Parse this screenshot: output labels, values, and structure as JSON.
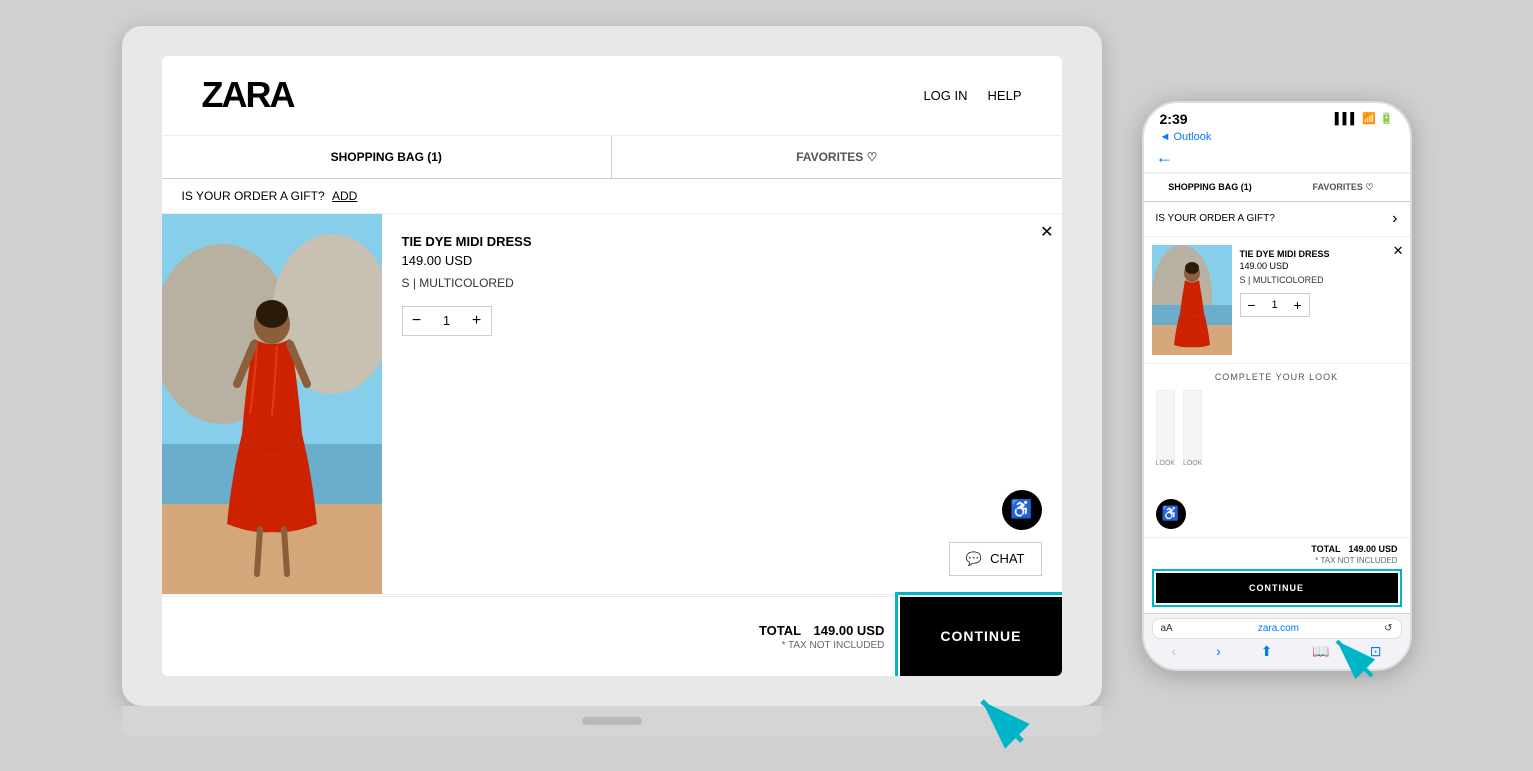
{
  "laptop": {
    "header": {
      "logo": "ZARA",
      "nav": [
        {
          "label": "LOG IN"
        },
        {
          "label": "HELP"
        }
      ]
    },
    "tabs": [
      {
        "label": "SHOPPING BAG (1)",
        "active": true
      },
      {
        "label": "FAVORITES ♡",
        "active": false
      }
    ],
    "gift_bar": {
      "text": "IS YOUR ORDER A GIFT?",
      "link": "ADD"
    },
    "product": {
      "name": "TIE DYE MIDI DRESS",
      "price": "149.00 USD",
      "variant": "S | MULTICOLORED",
      "quantity": 1
    },
    "accessibility_icon": "♿",
    "chat_label": "CHAT",
    "checkout": {
      "total_label": "TOTAL",
      "total_amount": "149.00 USD",
      "tax_note": "* TAX NOT INCLUDED",
      "continue_label": "CONTINUE"
    }
  },
  "mobile": {
    "status_bar": {
      "time": "2:39",
      "back_app": "◄ Outlook",
      "signal": "▌▌▌",
      "wifi": "▲",
      "battery": "▮▮▮"
    },
    "back_arrow": "←",
    "tabs": [
      {
        "label": "SHOPPING BAG (1)",
        "active": true
      },
      {
        "label": "FAVORITES ♡",
        "active": false
      }
    ],
    "gift_bar": {
      "text": "IS YOUR ORDER A GIFT?",
      "arrow": "›"
    },
    "product": {
      "name": "TIE DYE MIDI DRESS",
      "price": "149.00 USD",
      "variant": "S | MULTICOLORED",
      "quantity": 1
    },
    "complete_look_label": "COMPLETE YOUR LOOK",
    "look_labels": [
      "LOOK",
      "LOOK"
    ],
    "checkout": {
      "total_label": "TOTAL",
      "total_amount": "149.00 USD",
      "tax_note": "* TAX NOT INCLUDED",
      "continue_label": "CONTINUE"
    },
    "browser": {
      "aa_label": "aA",
      "url": "zara.com",
      "reload_icon": "↺"
    }
  }
}
